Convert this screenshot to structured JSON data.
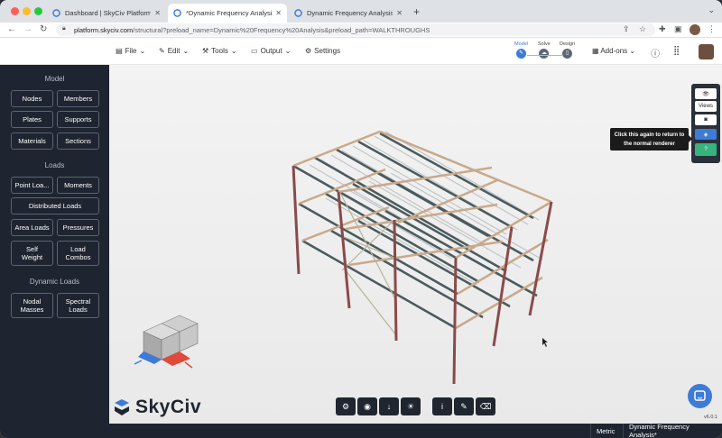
{
  "browser": {
    "tabs": [
      {
        "title": "Dashboard | SkyCiv Platform",
        "active": false
      },
      {
        "title": "*Dynamic Frequency Analysis |",
        "active": true
      },
      {
        "title": "Dynamic Frequency Analysis |",
        "active": false
      }
    ],
    "url_host": "platform.skyciv.com",
    "url_path": "/structural?preload_name=Dynamic%20Frequency%20Analysis&preload_path=WALKTHROUGHS"
  },
  "header": {
    "menus": [
      "File",
      "Edit",
      "Tools",
      "Output",
      "Settings"
    ],
    "stages": [
      "Model",
      "Solve",
      "Design"
    ],
    "addons": "Add-ons"
  },
  "sidebar": {
    "model_title": "Model",
    "model_buttons": [
      "Nodes",
      "Members",
      "Plates",
      "Supports",
      "Materials",
      "Sections"
    ],
    "loads_title": "Loads",
    "loads_buttons": [
      "Point Loa...",
      "Moments",
      "Distributed Loads",
      "Area Loads",
      "Pressures",
      "Self Weight",
      "Load Combos"
    ],
    "dynamic_title": "Dynamic Loads",
    "dynamic_buttons": [
      "Nodal Masses",
      "Spectral Loads"
    ]
  },
  "right_toolbar": {
    "views_label": "Views"
  },
  "tooltip": {
    "text": "Click this again to return to the normal renderer"
  },
  "logo_text": "SkyCiv",
  "version": "v6.0.1",
  "status": {
    "units": "Metric",
    "project": "Dynamic Frequency Analysis*"
  },
  "colors": {
    "sidebar_bg": "#1e2530",
    "accent": "#3e7bd6",
    "column_color": "#8b4a4a",
    "beam_color": "#c9a98a"
  }
}
